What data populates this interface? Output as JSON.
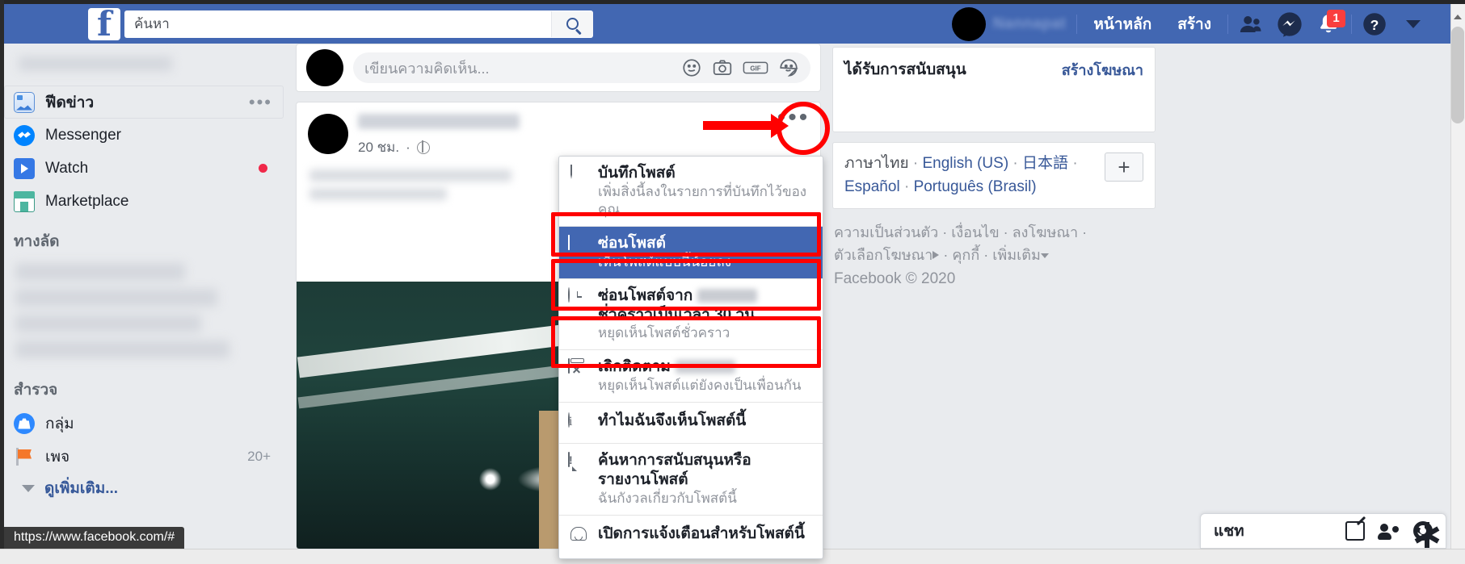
{
  "browser": {
    "status_url": "https://www.facebook.com/#"
  },
  "header": {
    "logo": "f",
    "search": {
      "placeholder": "ค้นหา",
      "value": ""
    },
    "profile_name": "Nannapat",
    "nav": [
      {
        "label": "หน้าหลัก",
        "name": "nav-home"
      },
      {
        "label": "สร้าง",
        "name": "nav-create"
      }
    ],
    "icons": [
      {
        "name": "friend-requests-icon",
        "badge": ""
      },
      {
        "name": "messenger-icon",
        "badge": ""
      },
      {
        "name": "notifications-icon",
        "badge": "1"
      },
      {
        "name": "help-icon",
        "badge": ""
      },
      {
        "name": "account-menu-caret-icon",
        "badge": ""
      }
    ],
    "notification_count": "1"
  },
  "sidebar": {
    "items": [
      {
        "label": "ฟีดข่าว",
        "icon": "news-feed-icon",
        "active": true,
        "badge": ""
      },
      {
        "label": "Messenger",
        "icon": "messenger-icon",
        "active": false,
        "badge": ""
      },
      {
        "label": "Watch",
        "icon": "watch-icon",
        "active": false,
        "badge": ""
      },
      {
        "label": "Marketplace",
        "icon": "marketplace-icon",
        "active": false,
        "badge": ""
      }
    ],
    "shortcuts_header": "ทางลัด",
    "explore_header": "สำรวจ",
    "explore_items": [
      {
        "label": "กลุ่ม",
        "icon": "groups-icon",
        "badge": ""
      },
      {
        "label": "เพจ",
        "icon": "pages-icon",
        "badge": "20+"
      }
    ],
    "see_more": "ดูเพิ่มเติม..."
  },
  "composer": {
    "placeholder": "เขียนความคิดเห็น...",
    "icons": [
      "emoji-icon",
      "camera-icon",
      "gif-icon",
      "sticker-icon"
    ]
  },
  "post": {
    "timestamp": "20 ชม.",
    "privacy": "public-globe-icon",
    "more_button": "post-options-button"
  },
  "menu": {
    "items": [
      {
        "title": "บันทึกโพสต์",
        "subtitle": "เพิ่มสิ่งนี้ลงในรายการที่บันทึกไว้ของคุณ",
        "icon": "bookmark-icon",
        "selected": false,
        "highlighted": false
      },
      {
        "title": "ซ่อนโพสต์",
        "subtitle": "เห็นโพสต์แบบนี้น้อยลง",
        "icon": "hide-post-icon",
        "selected": true,
        "highlighted": true
      },
      {
        "title": "ซ่อนโพสต์จาก",
        "title2": "ชั่วคราวเป็นเวลา 30 วัน",
        "subtitle": "หยุดเห็นโพสต์ชั่วคราว",
        "icon": "snooze-clock-icon",
        "selected": false,
        "highlighted": true
      },
      {
        "title": "เลิกติดตาม",
        "subtitle": "หยุดเห็นโพสต์แต่ยังคงเป็นเพื่อนกัน",
        "icon": "unfollow-icon",
        "selected": false,
        "highlighted": true
      },
      {
        "title": "ทำไมฉันจึงเห็นโพสต์นี้",
        "subtitle": "",
        "icon": "info-icon",
        "selected": false,
        "highlighted": false
      },
      {
        "title": "ค้นหาการสนับสนุนหรือ",
        "title2": "รายงานโพสต์",
        "subtitle": "ฉันกังวลเกี่ยวกับโพสต์นี้",
        "icon": "report-icon",
        "selected": false,
        "highlighted": false
      },
      {
        "title": "เปิดการแจ้งเตือนสำหรับโพสต์นี้",
        "subtitle": "",
        "icon": "bell-icon",
        "selected": false,
        "highlighted": false
      }
    ]
  },
  "right": {
    "sponsored_title": "ได้รับการสนับสนุน",
    "create_ad": "สร้างโฆษณา",
    "languages": [
      {
        "label": "ภาษาไทย",
        "current": true
      },
      {
        "label": "English (US)",
        "current": false
      },
      {
        "label": "日本語",
        "current": false
      },
      {
        "label": "Español",
        "current": false
      },
      {
        "label": "Português (Brasil)",
        "current": false
      }
    ],
    "add_language": "+",
    "footer_links": [
      "ความเป็นส่วนตัว",
      "เงื่อนไข",
      "ลงโฆษณา",
      "ตัวเลือกโฆษณา",
      "คุกกี้",
      "เพิ่มเติม"
    ],
    "copyright": "Facebook © 2020"
  },
  "chat": {
    "title": "แชท",
    "icons": [
      "new-message-icon",
      "add-friend-icon",
      "chat-settings-icon"
    ]
  },
  "colors": {
    "fb_blue": "#4267b2",
    "link_blue": "#385898",
    "annotation_red": "#ff0000",
    "badge_red": "#fa3e3e"
  }
}
